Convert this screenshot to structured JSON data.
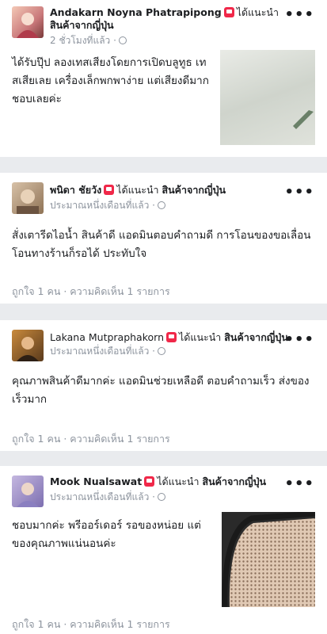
{
  "posts": [
    {
      "author": "Andakarn Noyna Phatrapipong",
      "recommends": "ได้แนะนำ",
      "page": "สินค้าจากญี่ปุ่น",
      "time": "2 ชั่วโมงที่แล้ว",
      "text_lines": [
        "ได้รับปุ๊ป ลองเทสเสียงโดยการเปิดบลูทูธ เท",
        "สเสียเลย เครื่องเล็กพกพาง่าย แต่เสียงดีมาก",
        "ชอบเลยค่ะ"
      ]
    },
    {
      "author": "พนิดา ชัยวัง",
      "recommends": "ได้แนะนำ",
      "page": "สินค้าจากญี่ปุ่น",
      "time": "ประมาณหนึ่งเดือนที่แล้ว",
      "text_lines": [
        "สั่งเตารีดไอน้ำ สินค้าดี แอดมินตอบคำถามดี การโอนของขอเลื่อน",
        "โอนทางร้านก็รอได้ ประทับใจ"
      ],
      "footer": "ถูกใจ 1 คน · ความคิดเห็น 1 รายการ"
    },
    {
      "author": "Lakana Mutpraphakorn",
      "recommends": "ได้แนะนำ",
      "page": "สินค้าจากญี่ปุ่น",
      "time": "ประมาณหนึ่งเดือนที่แล้ว",
      "text_lines": [
        "คุณภาพสินค้าดีมากค่ะ แอดมินช่วยเหลือดี ตอบคำถามเร็ว ส่งของ",
        "เร็วมาก"
      ],
      "footer": "ถูกใจ 1 คน · ความคิดเห็น 1 รายการ"
    },
    {
      "author": "Mook Nualsawat",
      "recommends": "ได้แนะนำ",
      "page": "สินค้าจากญี่ปุ่น",
      "time": "ประมาณหนึ่งเดือนที่แล้ว",
      "text_lines": [
        "ชอบมากค่ะ พรีออร์เดอร์ รอของหน่อย แต่",
        "ของคุณภาพแน่นอนค่ะ"
      ],
      "footer": "ถูกใจ 1 คน · ความคิดเห็น 1 รายการ"
    }
  ],
  "icons": {
    "recommend": "recommend-badge-icon",
    "privacy": "globe-icon",
    "more": "more-options-icon"
  },
  "colors": {
    "recommend_badge": "#f02849",
    "meta_text": "#8d949e",
    "feed_background": "#e9ebee"
  }
}
